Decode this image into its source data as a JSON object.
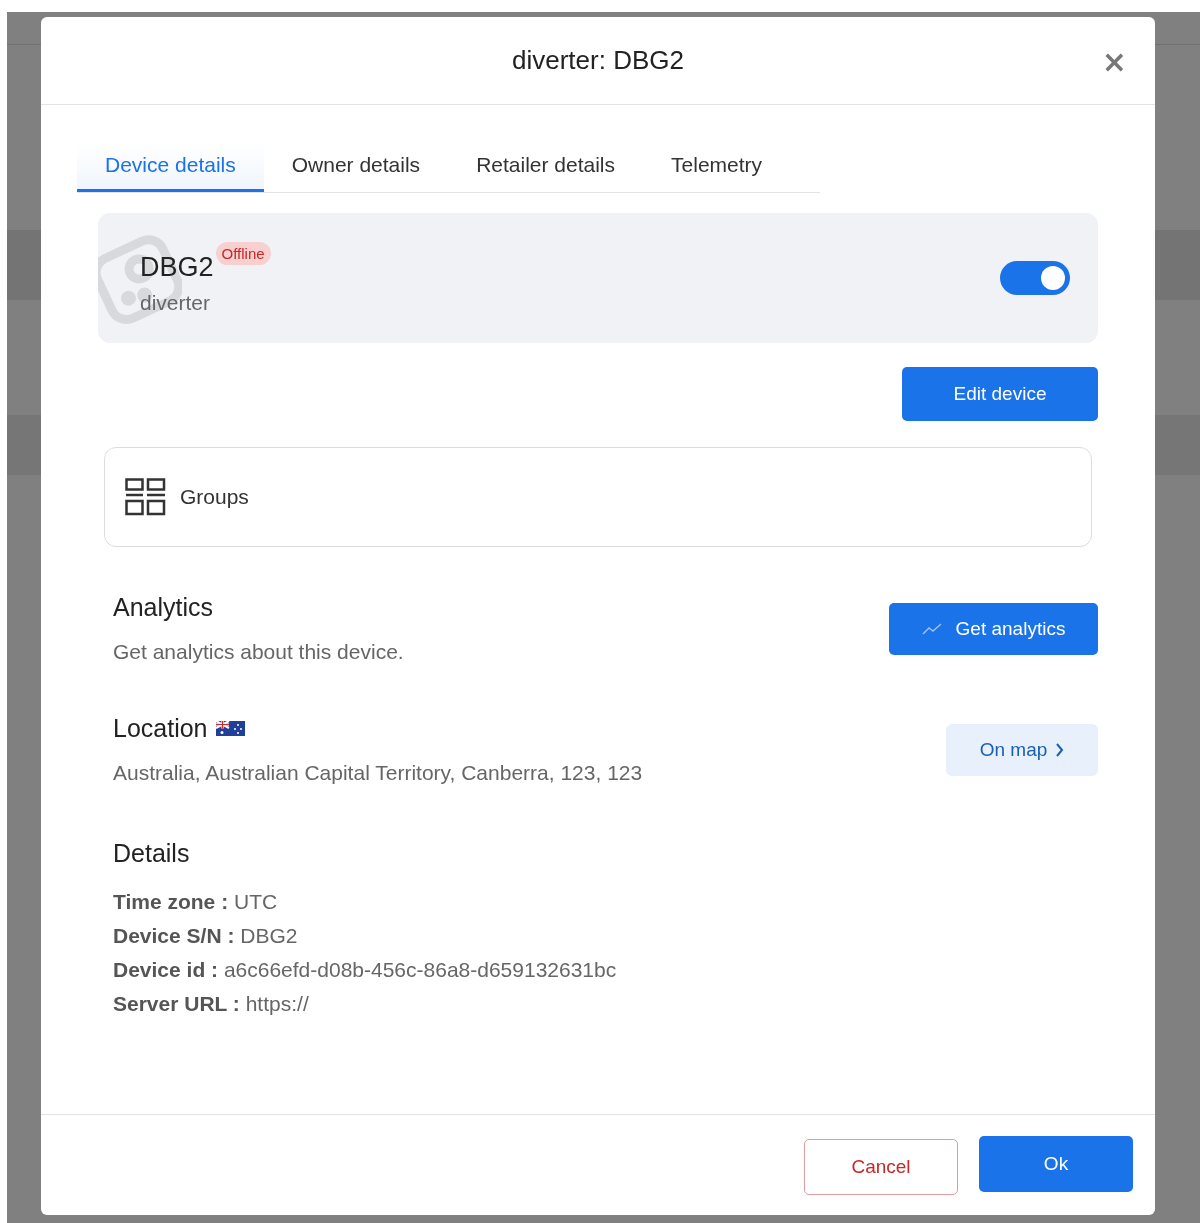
{
  "dialog": {
    "title": "diverter: DBG2",
    "close": "×"
  },
  "tabs": [
    {
      "label": "Device details",
      "selected": true
    },
    {
      "label": "Owner details",
      "selected": false
    },
    {
      "label": "Retailer details",
      "selected": false
    },
    {
      "label": "Telemetry",
      "selected": false
    }
  ],
  "device": {
    "name": "DBG2",
    "status": "Offline",
    "type": "diverter",
    "enabled": true
  },
  "edit_button": "Edit device",
  "groups": {
    "label": "Groups"
  },
  "analytics": {
    "title": "Analytics",
    "description": "Get analytics about this device.",
    "button": "Get analytics"
  },
  "location": {
    "title": "Location",
    "address": "Australia, Australian Capital Territory, Canberra, 123, 123",
    "button": "On map"
  },
  "details": {
    "title": "Details",
    "rows": [
      {
        "label": "Time zone :",
        "value": "UTC"
      },
      {
        "label": "Device S/N :",
        "value": "DBG2"
      },
      {
        "label": "Device id :",
        "value": "a6c66efd-d08b-456c-86a8-d659132631bc"
      },
      {
        "label": "Server URL :",
        "value": "https://"
      }
    ]
  },
  "footer": {
    "cancel": "Cancel",
    "ok": "Ok"
  }
}
